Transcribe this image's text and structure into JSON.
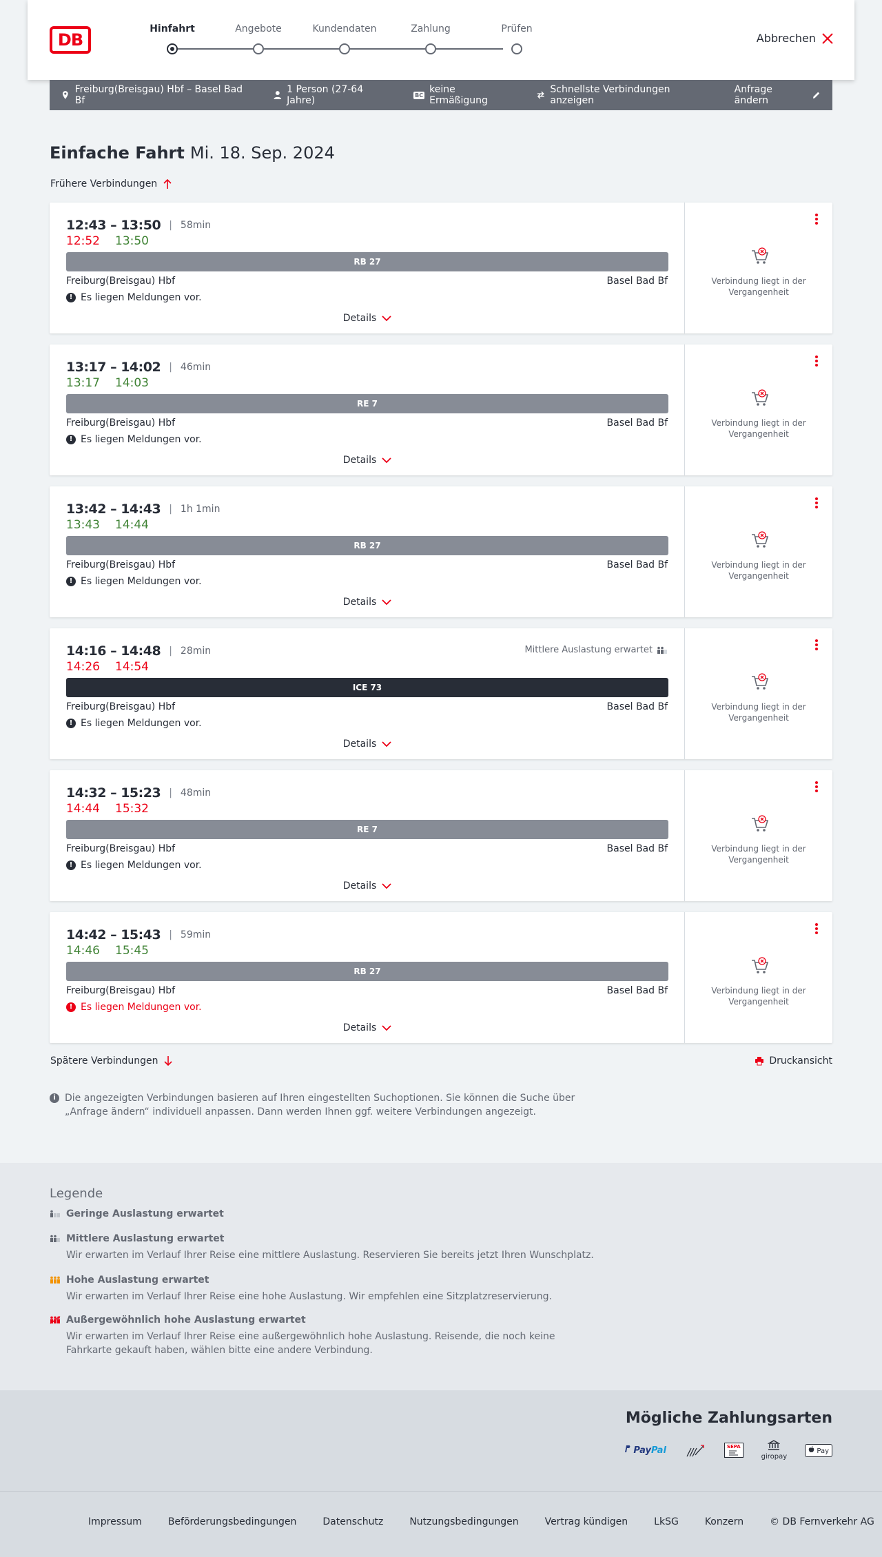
{
  "header": {
    "logo": "DB",
    "steps": [
      {
        "label": "Hinfahrt",
        "active": true
      },
      {
        "label": "Angebote",
        "active": false
      },
      {
        "label": "Kundendaten",
        "active": false
      },
      {
        "label": "Zahlung",
        "active": false
      },
      {
        "label": "Prüfen",
        "active": false
      }
    ],
    "cancel_label": "Abbrechen"
  },
  "query": {
    "route": "Freiburg(Breisgau) Hbf – Basel Bad Bf",
    "persons": "1 Person (27-64 Jahre)",
    "discount_badge": "BC",
    "discount": "keine Ermäßigung",
    "fastest": "Schnellste Verbindungen anzeigen",
    "edit": "Anfrage ändern"
  },
  "title": {
    "type": "Einfache Fahrt",
    "date": "Mi. 18. Sep. 2024"
  },
  "earlier_label": "Frühere Verbindungen",
  "later_label": "Spätere Verbindungen",
  "print_label": "Druckansicht",
  "connections": [
    {
      "planned": "12:43 – 13:50",
      "duration": "58min",
      "rt_dep": "12:52",
      "rt_dep_late": true,
      "rt_arr": "13:50",
      "rt_arr_late": false,
      "train": "RB 27",
      "ice": false,
      "from": "Freiburg(Breisgau) Hbf",
      "to": "Basel Bad Bf",
      "notice": "Es liegen Meldungen vor.",
      "notice_red": false,
      "occupancy": "",
      "details": "Details",
      "side_text": "Verbindung liegt in der Vergangenheit"
    },
    {
      "planned": "13:17 – 14:02",
      "duration": "46min",
      "rt_dep": "13:17",
      "rt_dep_late": false,
      "rt_arr": "14:03",
      "rt_arr_late": false,
      "train": "RE 7",
      "ice": false,
      "from": "Freiburg(Breisgau) Hbf",
      "to": "Basel Bad Bf",
      "notice": "Es liegen Meldungen vor.",
      "notice_red": false,
      "occupancy": "",
      "details": "Details",
      "side_text": "Verbindung liegt in der Vergangenheit"
    },
    {
      "planned": "13:42 – 14:43",
      "duration": "1h 1min",
      "rt_dep": "13:43",
      "rt_dep_late": false,
      "rt_arr": "14:44",
      "rt_arr_late": false,
      "train": "RB 27",
      "ice": false,
      "from": "Freiburg(Breisgau) Hbf",
      "to": "Basel Bad Bf",
      "notice": "Es liegen Meldungen vor.",
      "notice_red": false,
      "occupancy": "",
      "details": "Details",
      "side_text": "Verbindung liegt in der Vergangenheit"
    },
    {
      "planned": "14:16 – 14:48",
      "duration": "28min",
      "rt_dep": "14:26",
      "rt_dep_late": true,
      "rt_arr": "14:54",
      "rt_arr_late": true,
      "train": "ICE 73",
      "ice": true,
      "from": "Freiburg(Breisgau) Hbf",
      "to": "Basel Bad Bf",
      "notice": "Es liegen Meldungen vor.",
      "notice_red": false,
      "occupancy": "Mittlere Auslastung erwartet",
      "details": "Details",
      "side_text": "Verbindung liegt in der Vergangenheit"
    },
    {
      "planned": "14:32 – 15:23",
      "duration": "48min",
      "rt_dep": "14:44",
      "rt_dep_late": true,
      "rt_arr": "15:32",
      "rt_arr_late": true,
      "train": "RE 7",
      "ice": false,
      "from": "Freiburg(Breisgau) Hbf",
      "to": "Basel Bad Bf",
      "notice": "Es liegen Meldungen vor.",
      "notice_red": false,
      "occupancy": "",
      "details": "Details",
      "side_text": "Verbindung liegt in der Vergangenheit"
    },
    {
      "planned": "14:42 – 15:43",
      "duration": "59min",
      "rt_dep": "14:46",
      "rt_dep_late": false,
      "rt_arr": "15:45",
      "rt_arr_late": false,
      "train": "RB 27",
      "ice": false,
      "from": "Freiburg(Breisgau) Hbf",
      "to": "Basel Bad Bf",
      "notice": "Es liegen Meldungen vor.",
      "notice_red": true,
      "occupancy": "",
      "details": "Details",
      "side_text": "Verbindung liegt in der Vergangenheit"
    }
  ],
  "info_text": "Die angezeigten Verbindungen basieren auf Ihren eingestellten Suchoptionen. Sie können die Suche über „Anfrage ändern“ individuell anpassen. Dann werden Ihnen ggf. weitere Verbindungen angezeigt.",
  "legend": {
    "title": "Legende",
    "items": [
      {
        "label": "Geringe Auslastung erwartet",
        "desc": "",
        "level": 1,
        "color": "#646973"
      },
      {
        "label": "Mittlere Auslastung erwartet",
        "desc": "Wir erwarten im Verlauf Ihrer Reise eine mittlere Auslastung. Reservieren Sie bereits jetzt Ihren Wunschplatz.",
        "level": 2,
        "color": "#646973"
      },
      {
        "label": "Hohe Auslastung erwartet",
        "desc": "Wir erwarten im Verlauf Ihrer Reise eine hohe Auslastung. Wir empfehlen eine Sitzplatzreservierung.",
        "level": 3,
        "color": "#f39200"
      },
      {
        "label": "Außergewöhnlich hohe Auslastung erwartet",
        "desc": "Wir erwarten im Verlauf Ihrer Reise eine außergewöhnlich hohe Auslastung. Reisende, die noch keine Fahrkarte gekauft haben, wählen bitte eine andere Verbindung.",
        "level": 4,
        "color": "#ec0016"
      }
    ]
  },
  "payment": {
    "title": "Mögliche Zahlungsarten",
    "paypal_a": "Pay",
    "paypal_b": "Pal",
    "sepa": "SEPA",
    "giropay": "giropay",
    "applepay": "Pay"
  },
  "footer": {
    "links": [
      "Impressum",
      "Beförderungsbedingungen",
      "Datenschutz",
      "Nutzungsbedingungen",
      "Vertrag kündigen",
      "LkSG",
      "Konzern",
      "© DB Fernverkehr AG"
    ]
  },
  "colors": {
    "accent": "#ec0016",
    "late": "#ec0016",
    "on_time": "#408335",
    "bar": "#878c96",
    "ice_bar": "#282d37"
  }
}
